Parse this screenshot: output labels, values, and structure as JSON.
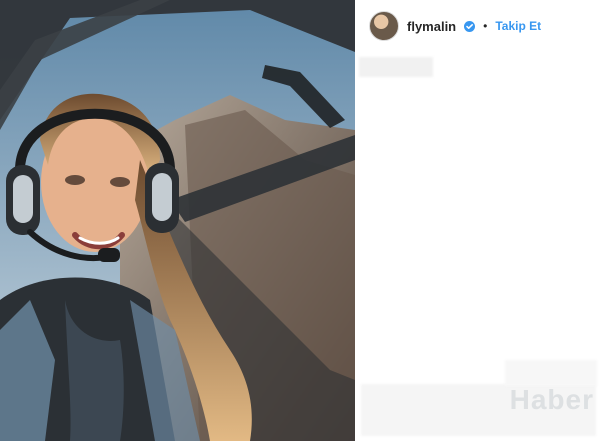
{
  "profile": {
    "username": "flymalin",
    "separator": "•",
    "follow_label": "Takip Et",
    "verified": true,
    "accent_color": "#3897f0"
  },
  "media": {
    "kind": "photo",
    "description_icon": "photo-icon"
  },
  "watermark": {
    "text": "Haber"
  }
}
